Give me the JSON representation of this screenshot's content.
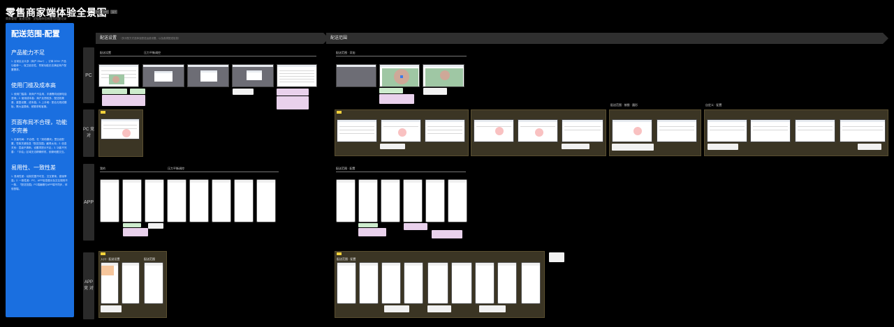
{
  "header": {
    "title": "零售商家端体验全景图",
    "subtitle": "商家管理 · 配送范围 · 全链路体验梳理与问题记录",
    "tags": [
      "PC",
      "APP",
      "设计"
    ]
  },
  "sidebar": {
    "title": "配送范围-配置",
    "sections": [
      {
        "heading": "产品能力不足",
        "body": "1. 目前区点众多（商户 25w+），订单 20%+ 产品功能单一，保卫延迟性，导致功能无法满足商户配置需求。"
      },
      {
        "heading": "使用门槛及成本高",
        "body": "1. 使用门槛高：新商户不会用，手通需向经销电话咨询；2. 使用成本高：商户反馈较多、配送效果差、重复设置，成本高；3. 上手难：配合无现成模板，需大量摸索，频繁求助客服。"
      },
      {
        "heading": "页面布局不合理，功能不完善",
        "body": "1. 页面布局：不合理，在「其他模块」里加设配置，导致关键信息「配送范围」藏得太深；2. 信息关系：层级不清晰，设置项提示不足；3. 功能不完善：「手绘」区域无法精确修改，依赖地图交互。"
      },
      {
        "heading": "易用性、一致性差",
        "body": "1. 易用性差：绘制范围不可控，交互繁琐，错误率高；2. 一致性差：PC、APP信息展示及交互规则不一致，「配送范围」PC端编辑与APP端不同步，体验割裂。"
      }
    ]
  },
  "bands": [
    {
      "label": "配送设置",
      "note": "（多分配方式选择及配送运费设置，以及各类配送信息）"
    },
    {
      "label": "配送范围",
      "note": ""
    }
  ],
  "rows": [
    {
      "label": "PC"
    },
    {
      "label": "PC 竞 对"
    },
    {
      "label": "APP"
    },
    {
      "label": "APP 竞 对"
    }
  ],
  "flow_labels": {
    "pc_a": "配送设置",
    "pc_b": "压力平衡调控",
    "pc_c": "配送范围 · 添加",
    "app_a": "我的",
    "app_b": "压力平衡调控",
    "app_c": "配送范围 · 配置",
    "cmp_a": "配送范围 · 按圈 · 圆形",
    "cmp_b": "自定义 · 配置",
    "cmp_c": "配送范围 · 配置",
    "app_cmp_a": "入口 · 配送设置",
    "app_cmp_b": "配送范围"
  },
  "colors": {
    "sidebar": "#1a6fe0",
    "note_green": "#cdeccd",
    "note_purple": "#e9d1ec",
    "panel": "#3b3524",
    "tag": "#f3d23b"
  }
}
